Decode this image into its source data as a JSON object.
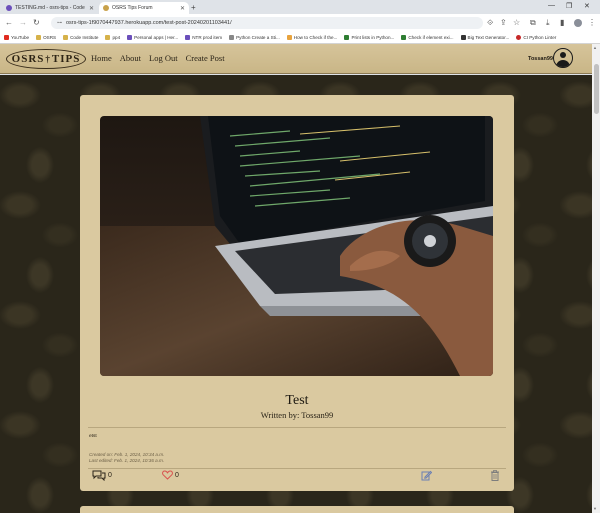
{
  "browser": {
    "tabs": [
      {
        "label": "TESTING.md - osrs-tips - Code",
        "active": false
      },
      {
        "label": "OSRS Tips Forum",
        "active": true
      }
    ],
    "url": "osrs-tips-1f9070447937.herokuapp.com/test-post-20240201103441/",
    "bookmarks": [
      "YouTube",
      "OSRS",
      "Code Institute",
      "pp4",
      "Personal apps | Her...",
      "NTR prod item",
      "Python Create a Sti...",
      "How to Check if the...",
      "Print lists in Python...",
      "Check if element exi...",
      "Big Text Generator...",
      "CI Python Linter"
    ]
  },
  "site": {
    "logo": {
      "left": "OSRS",
      "right": "TIPS"
    },
    "nav": [
      "Home",
      "About",
      "Log Out",
      "Create Post"
    ],
    "username": "Tossan99"
  },
  "post": {
    "title": "Test",
    "author": "Written by: Tossan99",
    "body": "etst",
    "created": "Created on: Feb. 1, 2024, 10:34 a.m.",
    "edited": "Last edited: Feb. 1, 2024, 10:36 a.m.",
    "comment_count": "0",
    "like_count": "0"
  },
  "colors": {
    "card": "#dac9a0",
    "like": "#d9534f",
    "edit": "#6a7fb4",
    "delete": "#7d7d7d"
  }
}
